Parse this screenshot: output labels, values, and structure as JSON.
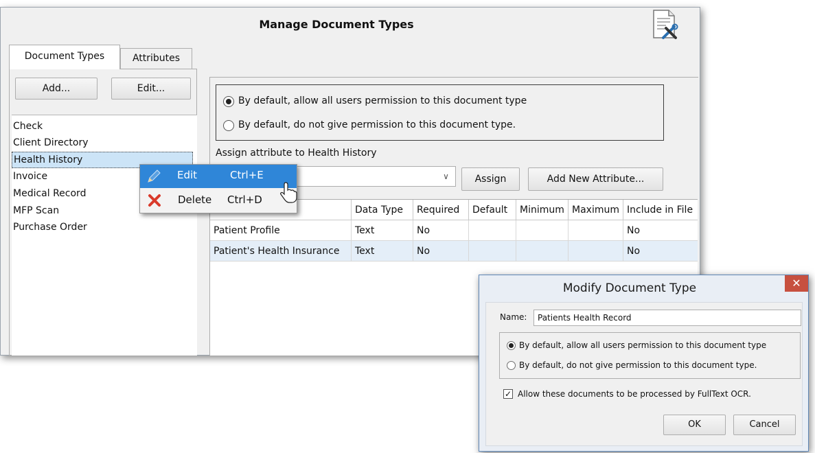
{
  "main_dialog": {
    "title": "Manage Document Types",
    "icon": "document-tools-icon",
    "tabs": [
      {
        "label": "Document Types",
        "selected": true
      },
      {
        "label": "Attributes",
        "selected": false
      }
    ],
    "add_label": "Add...",
    "edit_label": "Edit...",
    "document_types": [
      "Check",
      "Client Directory",
      "Health History",
      "Invoice",
      "Medical Record",
      "MFP Scan",
      "Purchase Order"
    ],
    "selected_type": "Health History",
    "permission_options": [
      {
        "label": "By default, allow all users permission to this document type",
        "checked": true
      },
      {
        "label": "By default, do not give permission to this document type.",
        "checked": false
      }
    ],
    "assign_label": "Assign attribute to Health History",
    "assign_button": "Assign",
    "add_new_attribute_button": "Add New Attribute...",
    "columns": [
      "Data Type",
      "Required",
      "Default",
      "Minimum",
      "Maximum",
      "Include in File"
    ],
    "rows": [
      {
        "name": "Patient Profile",
        "data_type": "Text",
        "required": "No",
        "default": "",
        "minimum": "",
        "maximum": "",
        "include_in_file": "No"
      },
      {
        "name": "Patient's Health Insurance",
        "data_type": "Text",
        "required": "No",
        "default": "",
        "minimum": "",
        "maximum": "",
        "include_in_file": "No"
      }
    ]
  },
  "context_menu": {
    "items": [
      {
        "label": "Edit",
        "shortcut": "Ctrl+E",
        "icon": "pencil-icon",
        "highlighted": true
      },
      {
        "label": "Delete",
        "shortcut": "Ctrl+D",
        "icon": "delete-x-icon",
        "highlighted": false
      }
    ]
  },
  "modify_dialog": {
    "title": "Modify Document Type",
    "close_glyph": "✕",
    "name_label": "Name:",
    "name_value": "Patients Health Record",
    "permission_options": [
      {
        "label": "By default, allow all users permission to this document type",
        "checked": true
      },
      {
        "label": "By default, do not give permission to this document type.",
        "checked": false
      }
    ],
    "ocr_label": "Allow these documents to be processed by FullText OCR.",
    "ocr_checked": true,
    "ok_label": "OK",
    "cancel_label": "Cancel"
  },
  "colors": {
    "menu_highlight": "#2f86d8",
    "selection": "#cce4f7",
    "close_button": "#c7503f",
    "delete_icon": "#d93a2b"
  }
}
